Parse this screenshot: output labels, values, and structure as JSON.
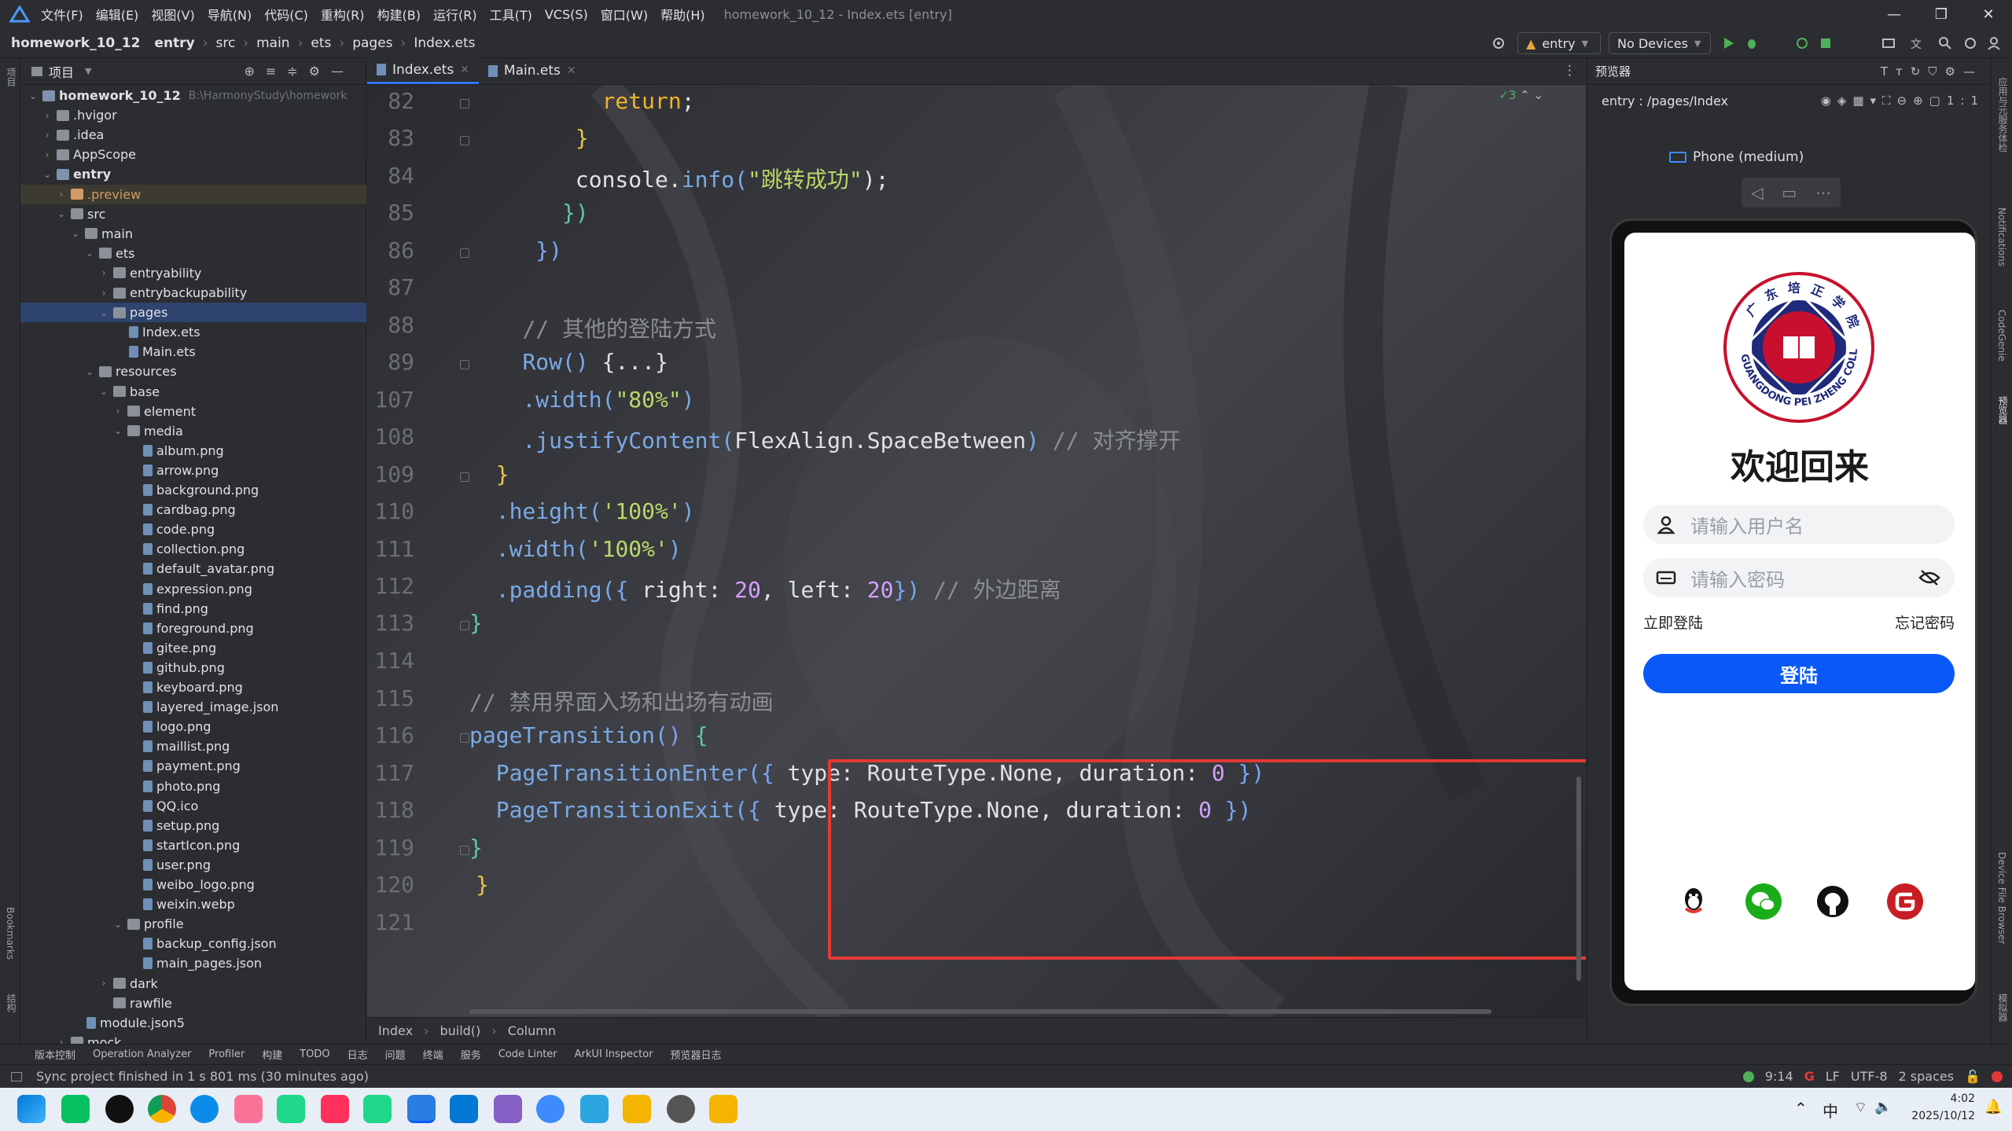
{
  "menubar": {
    "items": [
      "文件(F)",
      "编辑(E)",
      "视图(V)",
      "导航(N)",
      "代码(C)",
      "重构(R)",
      "构建(B)",
      "运行(R)",
      "工具(T)",
      "VCS(S)",
      "窗口(W)",
      "帮助(H)"
    ],
    "window_title": "homework_10_12 - Index.ets [entry]",
    "controls": [
      "—",
      "❐",
      "✕"
    ]
  },
  "navbar": {
    "crumbs": [
      "homework_10_12",
      "entry",
      "src",
      "main",
      "ets",
      "pages",
      "Index.ets"
    ],
    "module_select": "entry",
    "device_select": "No Devices"
  },
  "left_strip": {
    "project": "项目",
    "bookmarks": "Bookmarks",
    "structure": "结构"
  },
  "project": {
    "title": "项目",
    "rows": [
      {
        "label": "homework_10_12",
        "extra": "B:\\HarmonyStudy\\homework",
        "bold": true
      },
      {
        "label": ".hvigor"
      },
      {
        "label": ".idea"
      },
      {
        "label": "AppScope"
      },
      {
        "label": "entry",
        "bold": true
      },
      {
        "label": ".preview"
      },
      {
        "label": "src"
      },
      {
        "label": "main"
      },
      {
        "label": "ets"
      },
      {
        "label": "entryability"
      },
      {
        "label": "entrybackupability"
      },
      {
        "label": "pages"
      },
      {
        "label": "Index.ets"
      },
      {
        "label": "Main.ets"
      },
      {
        "label": "resources"
      },
      {
        "label": "base"
      },
      {
        "label": "element"
      },
      {
        "label": "media"
      },
      {
        "label": "album.png"
      },
      {
        "label": "arrow.png"
      },
      {
        "label": "background.png"
      },
      {
        "label": "cardbag.png"
      },
      {
        "label": "code.png"
      },
      {
        "label": "collection.png"
      },
      {
        "label": "default_avatar.png"
      },
      {
        "label": "expression.png"
      },
      {
        "label": "find.png"
      },
      {
        "label": "foreground.png"
      },
      {
        "label": "gitee.png"
      },
      {
        "label": "github.png"
      },
      {
        "label": "keyboard.png"
      },
      {
        "label": "layered_image.json"
      },
      {
        "label": "logo.png"
      },
      {
        "label": "maillist.png"
      },
      {
        "label": "payment.png"
      },
      {
        "label": "photo.png"
      },
      {
        "label": "QQ.ico"
      },
      {
        "label": "setup.png"
      },
      {
        "label": "startIcon.png"
      },
      {
        "label": "user.png"
      },
      {
        "label": "weibo_logo.png"
      },
      {
        "label": "weixin.webp"
      },
      {
        "label": "profile"
      },
      {
        "label": "backup_config.json"
      },
      {
        "label": "main_pages.json"
      },
      {
        "label": "dark"
      },
      {
        "label": "rawfile"
      },
      {
        "label": "module.json5"
      },
      {
        "label": "mock"
      }
    ]
  },
  "editor": {
    "tabs": [
      {
        "label": "Index.ets",
        "active": true
      },
      {
        "label": "Main.ets",
        "active": false
      }
    ],
    "inspection_count": "3",
    "line_numbers": [
      "82",
      "83",
      "84",
      "85",
      "86",
      "87",
      "88",
      "89",
      "107",
      "108",
      "109",
      "110",
      "111",
      "112",
      "113",
      "114",
      "115",
      "116",
      "117",
      "118",
      "119",
      "120",
      "121"
    ],
    "code": {
      "l82": {
        "a": "return",
        "b": ";"
      },
      "l83": "}",
      "l84": {
        "a": "console.",
        "b": "info",
        "c": "(",
        "d": "\"跳转成功\"",
        "e": ");"
      },
      "l85": "})",
      "l86": "})",
      "l88": "// 其他的登陆方式",
      "l89": {
        "a": "Row",
        "b": "() ",
        "c": "{...}"
      },
      "l107": {
        "a": ".width(",
        "b": "\"80%\"",
        "c": ")"
      },
      "l108": {
        "a": ".justifyContent(",
        "b": "FlexAlign.SpaceBetween",
        "c": ") ",
        "d": "// 对齐撑开"
      },
      "l109": "}",
      "l110": {
        "a": ".height(",
        "b": "'100%'",
        "c": ")"
      },
      "l111": {
        "a": ".width(",
        "b": "'100%'",
        "c": ")"
      },
      "l112": {
        "a": ".padding(",
        "b": "{ ",
        "c": "right",
        "d": ": ",
        "e": "20",
        "f": ", ",
        "g": "left",
        "h": ": ",
        "i": "20",
        "j": "}",
        "k": ") ",
        "l": "// 外边距离"
      },
      "l113": "}",
      "l115": "// 禁用界面入场和出场有动画",
      "l116": {
        "a": "pageTransition",
        "b": "() ",
        "c": "{"
      },
      "l117": {
        "a": "PageTransitionEnter",
        "b": "({ ",
        "c": "type",
        "d": ": RouteType.None, ",
        "e": "duration",
        "f": ": ",
        "g": "0",
        "h": " })"
      },
      "l118": {
        "a": "PageTransitionExit",
        "b": "({ ",
        "c": "type",
        "d": ": RouteType.None, ",
        "e": "duration",
        "f": ": ",
        "g": "0",
        "h": " })"
      },
      "l119": "}",
      "l120": "}"
    },
    "breadcrumb": [
      "Index",
      "build()",
      "Column"
    ]
  },
  "preview": {
    "title": "预览器",
    "route": "entry : /pages/Index",
    "device": "Phone (medium)",
    "app": {
      "college_cn": "广东培正学院",
      "college_en": "GUANGDONG PEI ZHENG COLLEGE",
      "welcome": "欢迎回来",
      "username_placeholder": "请输入用户名",
      "password_placeholder": "请输入密码",
      "register_link": "立即登陆",
      "forgot_link": "忘记密码",
      "login_button": "登陆"
    }
  },
  "right_strip": {
    "a": "应用与元服务体检",
    "b": "Notifications",
    "c": "CodeGenie",
    "d": "预览器",
    "e": "Device File Browser",
    "f": "模拟器"
  },
  "toolbar": {
    "items": [
      "版本控制",
      "Operation Analyzer",
      "Profiler",
      "构建",
      "TODO",
      "日志",
      "问题",
      "终端",
      "服务",
      "Code Linter",
      "ArkUI Inspector",
      "预览器日志"
    ]
  },
  "statusbar": {
    "message": "Sync project finished in 1 s 801 ms (30 minutes ago)",
    "position": "9:14",
    "line_sep": "LF",
    "encoding": "UTF-8",
    "indent": "2 spaces"
  },
  "taskbar": {
    "ime": "中",
    "time": "4:02",
    "date": "2025/10/12"
  },
  "colors": {
    "accent": "#3574f0",
    "highlight_box": "#e53935",
    "login_button": "#0a59f7",
    "seal_red": "#c8102e",
    "seal_blue": "#1f2a7a"
  }
}
